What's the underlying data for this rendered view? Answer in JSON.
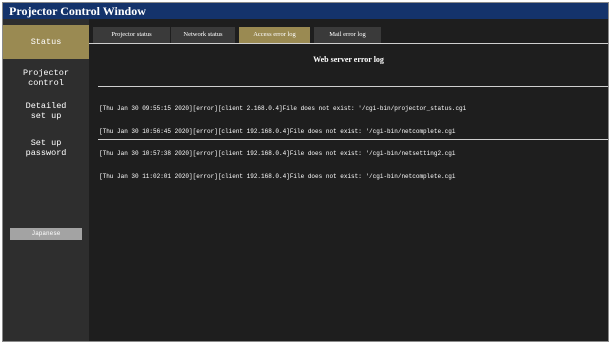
{
  "window": {
    "title": "Projector Control Window"
  },
  "sidebar": {
    "items": [
      {
        "label": "Status"
      },
      {
        "label": "Projector\ncontrol"
      },
      {
        "label": "Detailed\nset up"
      },
      {
        "label": "Set up\npassword"
      }
    ],
    "language_button": "Japanese"
  },
  "tabs": [
    {
      "label": "Projector status"
    },
    {
      "label": "Network status"
    },
    {
      "label": "Access error log"
    },
    {
      "label": "Mail error log"
    }
  ],
  "panel": {
    "title": "Web server error log",
    "log_lines": [
      "[Thu Jan 30 09:55:15 2020][error][client 2.168.0.4]File does not exist: '/cgi-bin/projector_status.cgi",
      "[Thu Jan 30 10:56:45 2020][error][client 192.168.0.4]File does not exist: '/cgi-bin/netcomplete.cgi",
      "[Thu Jan 30 10:57:38 2020][error][client 192.168.0.4]File does not exist: '/cgi-bin/netsetting2.cgi",
      "[Thu Jan 30 11:02:01 2020][error][client 192.168.0.4]File does not exist: '/cgi-bin/netcomplete.cgi"
    ]
  },
  "colors": {
    "titlebar": "#14336b",
    "active": "#9a8a52",
    "background": "#1e1e1e"
  }
}
